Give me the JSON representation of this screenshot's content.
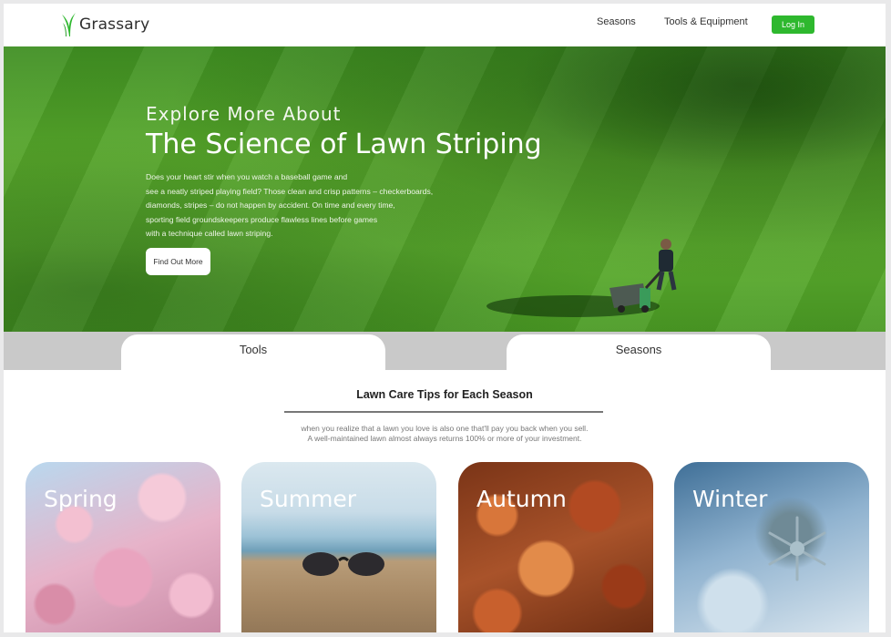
{
  "header": {
    "brand": "Grassary",
    "nav": {
      "seasons": "Seasons",
      "tools": "Tools & Equipment"
    },
    "login_label": "Log In",
    "accent": "#2eb82e"
  },
  "hero": {
    "kicker": "Explore More About",
    "title": "The Science of Lawn Striping",
    "lines": [
      "Does your heart stir when you watch a baseball game and",
      "see a neatly striped playing field? Those clean and crisp patterns – checkerboards,",
      "diamonds, stripes – do not happen by accident. On time and every time,",
      "sporting field groundskeepers produce flawless lines before games",
      "with a technique called lawn striping."
    ],
    "cta_label": "Find Out More"
  },
  "tabs": {
    "tools": "Tools",
    "seasons": "Seasons"
  },
  "section": {
    "title": "Lawn Care Tips for Each Season",
    "subtitle_lines": [
      "when you realize that a lawn you love is also one that'll pay you back when you sell.",
      "A well-maintained lawn almost always returns 100% or more of your investment."
    ]
  },
  "cards": [
    {
      "label": "Spring"
    },
    {
      "label": "Summer"
    },
    {
      "label": "Autumn"
    },
    {
      "label": "Winter"
    }
  ],
  "icons": [
    "grass-logo-icon",
    "mower-illustration",
    "sunglasses-illustration",
    "snowflake-illustration"
  ]
}
